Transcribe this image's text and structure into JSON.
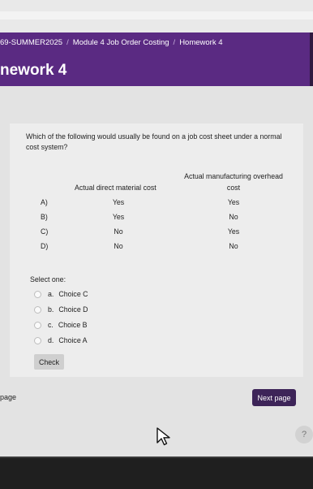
{
  "breadcrumb": {
    "course": "69-SUMMER2025",
    "module": "Module 4 Job Order Costing",
    "page": "Homework 4",
    "separator": "/"
  },
  "title": "nework 4",
  "question": {
    "text": "Which of the following would usually be found on a job cost sheet under a normal cost system?",
    "col1_header": "Actual direct material cost",
    "col2_header_line1": "Actual manufacturing overhead",
    "col2_header_line2": "cost",
    "rows": [
      {
        "label": "A)",
        "c1": "Yes",
        "c2": "Yes"
      },
      {
        "label": "B)",
        "c1": "Yes",
        "c2": "No"
      },
      {
        "label": "C)",
        "c1": "No",
        "c2": "Yes"
      },
      {
        "label": "D)",
        "c1": "No",
        "c2": "No"
      }
    ]
  },
  "select_one": "Select one:",
  "options": [
    {
      "letter": "a.",
      "text": "Choice C"
    },
    {
      "letter": "b.",
      "text": "Choice D"
    },
    {
      "letter": "c.",
      "text": "Choice B"
    },
    {
      "letter": "d.",
      "text": "Choice A"
    }
  ],
  "check_label": "Check",
  "prev_label": "page",
  "next_label": "Next page",
  "help_label": "?",
  "colors": {
    "banner": "#5a2a82",
    "next_button": "#3d2458",
    "card": "#ededed"
  }
}
